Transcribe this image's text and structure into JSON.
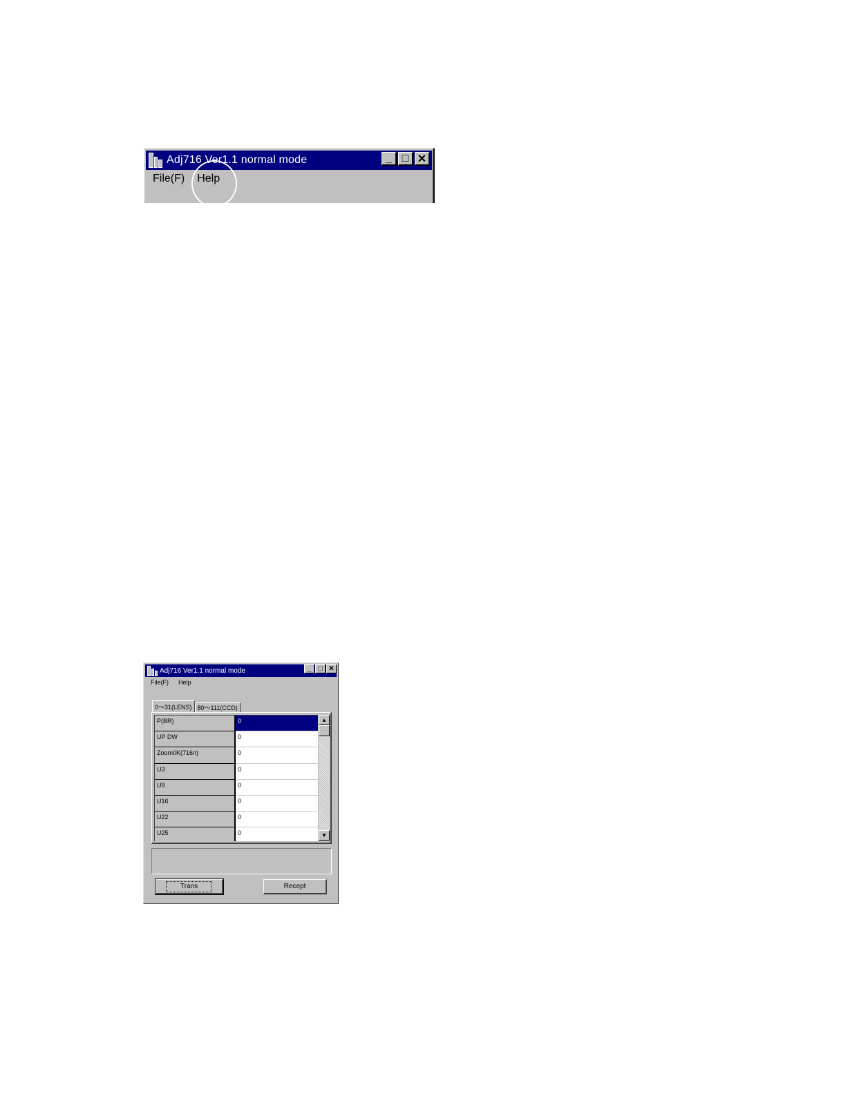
{
  "window": {
    "title": "Adj716 Ver1.1 normal mode",
    "menu": {
      "file": "File(F)",
      "help": "Help"
    },
    "controls": {
      "minimize": "_",
      "maximize": "□",
      "close": "✕"
    }
  },
  "tabs": [
    {
      "label": "0～31(LENS)",
      "active": true
    },
    {
      "label": "80～111(CCD)",
      "active": false
    }
  ],
  "grid": {
    "rows": [
      {
        "label": "P(BR)",
        "value": "0",
        "selected": true
      },
      {
        "label": "UP DW",
        "value": "0"
      },
      {
        "label": "Zoom0K(716n)",
        "value": "0"
      },
      {
        "label": "U3",
        "value": "0"
      },
      {
        "label": "U9",
        "value": "0"
      },
      {
        "label": "U16",
        "value": "0"
      },
      {
        "label": "U22",
        "value": "0"
      },
      {
        "label": "U25",
        "value": "0"
      }
    ]
  },
  "buttons": {
    "trans": "Trans",
    "recept": "Recept"
  },
  "scroll": {
    "up": "▲",
    "down": "▼"
  },
  "colors": {
    "titlebar": "#000080",
    "face": "#c0c0c0",
    "selection": "#000080"
  }
}
